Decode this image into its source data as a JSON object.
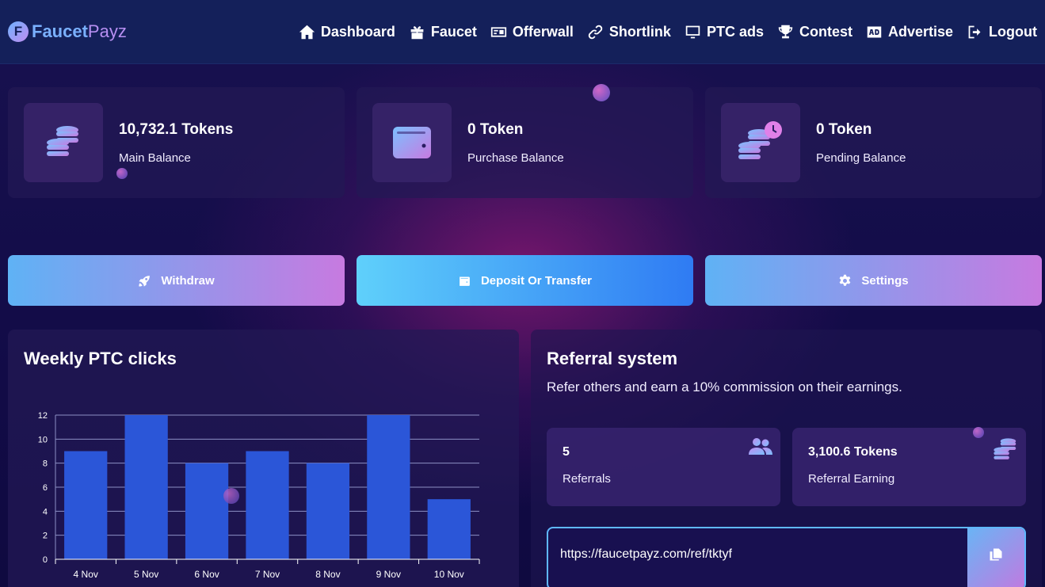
{
  "brand": {
    "name_part1": "Faucet",
    "name_part2": "Payz",
    "logo_letter": "F"
  },
  "nav": {
    "items": [
      {
        "label": "Dashboard",
        "icon": "home-icon"
      },
      {
        "label": "Faucet",
        "icon": "gift-icon"
      },
      {
        "label": "Offerwall",
        "icon": "money-bill-icon"
      },
      {
        "label": "Shortlink",
        "icon": "link-icon"
      },
      {
        "label": "PTC ads",
        "icon": "monitor-icon"
      },
      {
        "label": "Contest",
        "icon": "trophy-icon"
      },
      {
        "label": "Advertise",
        "icon": "ad-icon"
      },
      {
        "label": "Logout",
        "icon": "logout-icon"
      }
    ]
  },
  "balances": [
    {
      "value": "10,732.1 Tokens",
      "label": "Main Balance",
      "icon": "coins-icon"
    },
    {
      "value": "0 Token",
      "label": "Purchase Balance",
      "icon": "wallet-icon"
    },
    {
      "value": "0 Token",
      "label": "Pending Balance",
      "icon": "coins-clock-icon"
    }
  ],
  "actions": {
    "withdraw": "Withdraw",
    "deposit": "Deposit Or Transfer",
    "settings": "Settings"
  },
  "weekly": {
    "title": "Weekly PTC clicks"
  },
  "chart_data": {
    "type": "bar",
    "categories": [
      "4 Nov",
      "5 Nov",
      "6 Nov",
      "7 Nov",
      "8 Nov",
      "9 Nov",
      "10 Nov"
    ],
    "values": [
      9,
      12,
      8,
      9,
      8,
      12,
      5
    ],
    "ylim": [
      0,
      12
    ],
    "yticks": [
      0,
      2,
      4,
      6,
      8,
      10,
      12
    ],
    "grid": true,
    "bar_color": "#2b56d8",
    "grid_color": "#8d8fc4"
  },
  "referral": {
    "title": "Referral system",
    "description": "Refer others and earn a 10% commission on their earnings.",
    "count_value": "5",
    "count_label": "Referrals",
    "earning_value": "3,100.6 Tokens",
    "earning_label": "Referral Earning",
    "link": "https://faucetpayz.com/ref/tktyf"
  },
  "colors": {
    "navbar_bg": "#14205a",
    "accent_blue": "#5fb8ff",
    "accent_purple": "#c77ae0"
  }
}
